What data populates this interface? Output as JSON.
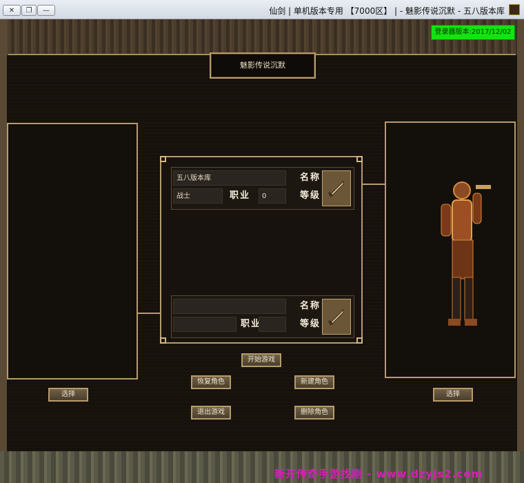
{
  "window": {
    "title": "仙剑 | 单机版本专用 【7000区】 | - 魅影传说沉默 - 五八版本库",
    "close_glyph": "✕",
    "restore_glyph": "❐",
    "minimize_glyph": "—"
  },
  "game": {
    "version_badge": "登录器版本:2017/12/02",
    "server_title": "魅影传说沉默",
    "slots": [
      {
        "name_label": "名称",
        "name_value": "五八版本库",
        "level_label": "等级",
        "level_value": "0",
        "job_label": "职业",
        "job_value": "战士"
      },
      {
        "name_label": "名称",
        "name_value": "",
        "level_label": "等级",
        "level_value": "",
        "job_label": "职业",
        "job_value": ""
      }
    ],
    "buttons": {
      "start_game": "开始游戏",
      "restore_char": "恢复角色",
      "new_char": "新建角色",
      "exit_game": "退出游戏",
      "delete_char": "删除角色",
      "select_left": "选择",
      "select_right": "选择"
    },
    "watermark": "新开传奇手游找刚 - www.dzyjs2.com",
    "icons": {
      "slot_icon": "sword-icon",
      "portrait": "warrior-portrait",
      "app_icon": "game-app-icon"
    },
    "colors": {
      "version_badge_bg": "#12e40f",
      "frame_gold": "#b89c6c",
      "watermark": "#d61fb8"
    }
  }
}
